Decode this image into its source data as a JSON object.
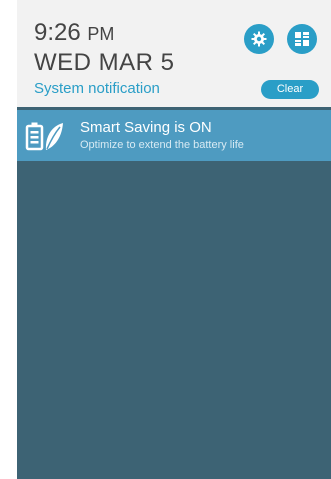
{
  "header": {
    "time": "9:26",
    "ampm": "PM",
    "date": "WED MAR 5",
    "section_title": "System notification",
    "clear_label": "Clear",
    "icons": {
      "settings": "gear-icon",
      "quick_settings": "quick-settings-icon"
    }
  },
  "notification": {
    "title": "Smart Saving is ON",
    "body": "Optimize to extend the battery life",
    "icon": "battery-leaf-icon"
  },
  "colors": {
    "accent": "#2a9ec7",
    "header_bg": "#f2f2f2",
    "shade_bg": "#3d6374",
    "card_bg": "#4e9bc1"
  }
}
